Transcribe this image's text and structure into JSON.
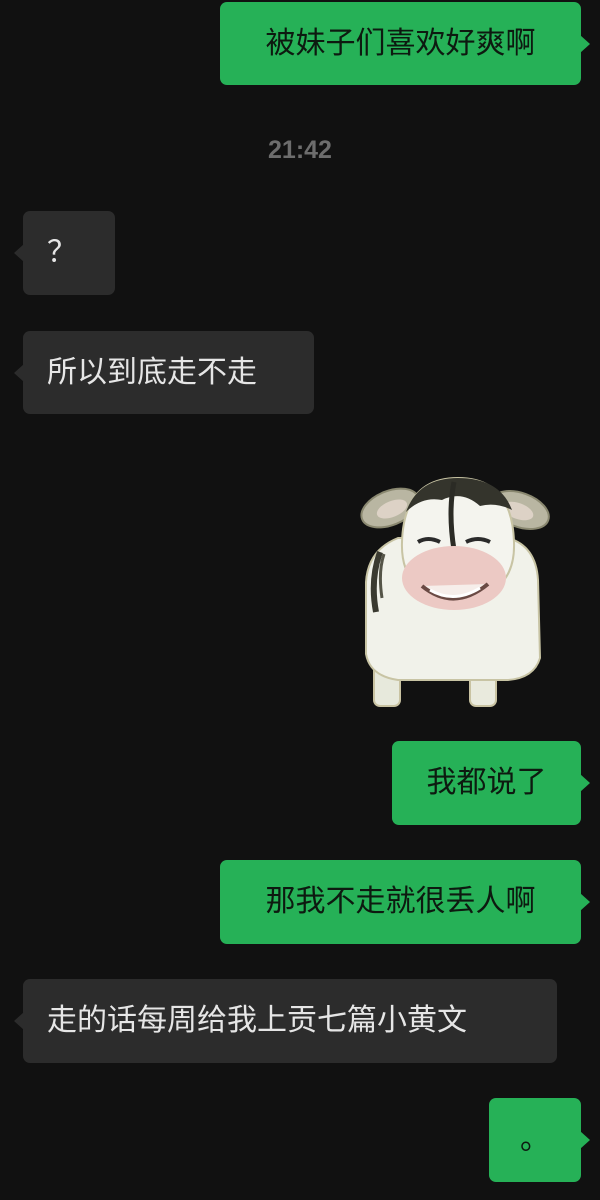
{
  "messages": [
    {
      "text": "被妹子们喜欢好爽啊",
      "side": "sent"
    },
    {
      "text": "？",
      "side": "received"
    },
    {
      "text": "所以到底走不走",
      "side": "received"
    },
    {
      "text": "我都说了",
      "side": "sent"
    },
    {
      "text": "那我不走就很丢人啊",
      "side": "sent"
    },
    {
      "text": "走的话每周给我上贡七篇小黄文",
      "side": "received"
    },
    {
      "text": "。",
      "side": "sent"
    }
  ],
  "timestamp": "21:42",
  "sticker": {
    "icon": "smiling-cow-sticker-icon"
  },
  "colors": {
    "background": "#111111",
    "sent_bubble": "#26b157",
    "received_bubble": "#2c2c2c",
    "timestamp": "#6d6d6d"
  }
}
